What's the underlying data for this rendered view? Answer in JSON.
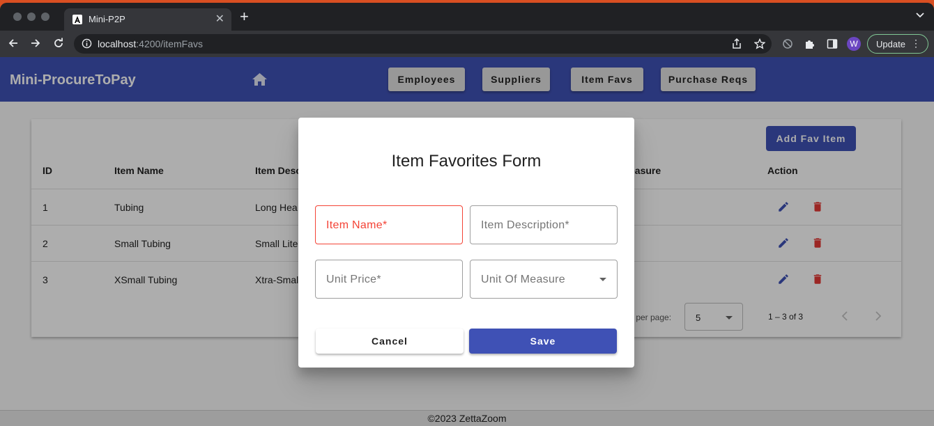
{
  "browser": {
    "tab_title": "Mini-P2P",
    "url_host": "localhost",
    "url_path": ":4200/itemFavs",
    "profile_initial": "W",
    "update_label": "Update"
  },
  "app": {
    "brand": "Mini-ProcureToPay",
    "nav": [
      "Employees",
      "Suppliers",
      "Item Favs",
      "Purchase Reqs"
    ]
  },
  "table": {
    "add_label": "Add Fav Item",
    "headers": {
      "id": "ID",
      "name": "Item Name",
      "desc": "Item Desc",
      "uom": "easure",
      "action": "Action"
    },
    "rows": [
      {
        "id": "1",
        "name": "Tubing",
        "desc": "Long Hea"
      },
      {
        "id": "2",
        "name": "Small Tubing",
        "desc": "Small Lite"
      },
      {
        "id": "3",
        "name": "XSmall Tubing",
        "desc": "Xtra-Smal"
      }
    ],
    "paginator": {
      "label": "s per page:",
      "page_size": "5",
      "range": "1 – 3 of 3"
    }
  },
  "dialog": {
    "title": "Item Favorites Form",
    "fields": {
      "item_name": "Item Name*",
      "item_description": "Item Description*",
      "unit_price": "Unit Price*",
      "unit_of_measure": "Unit Of Measure"
    },
    "cancel_label": "Cancel",
    "save_label": "Save"
  },
  "footer": {
    "text": "©2023 ZettaZoom"
  },
  "colors": {
    "primary": "#3f51b5",
    "warn": "#e53935",
    "error": "#f44336"
  },
  "icons": [
    "home-icon",
    "edit-icon",
    "delete-icon",
    "chevron-left-icon",
    "chevron-right-icon"
  ]
}
